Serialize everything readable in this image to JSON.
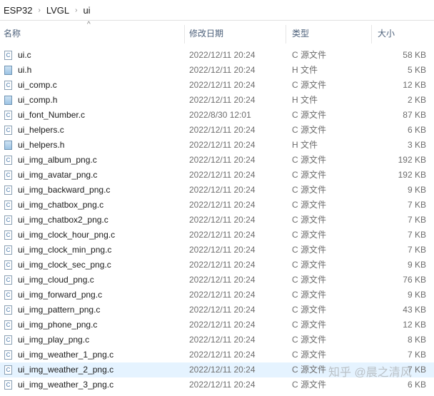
{
  "breadcrumb": [
    "ESP32",
    "LVGL",
    "ui"
  ],
  "columns": {
    "name": "名称",
    "modified": "修改日期",
    "type": "类型",
    "size": "大小"
  },
  "files": [
    {
      "name": "ui.c",
      "date": "2022/12/11 20:24",
      "type": "C 源文件",
      "size": "58 KB",
      "icon": "c"
    },
    {
      "name": "ui.h",
      "date": "2022/12/11 20:24",
      "type": "H 文件",
      "size": "5 KB",
      "icon": "h"
    },
    {
      "name": "ui_comp.c",
      "date": "2022/12/11 20:24",
      "type": "C 源文件",
      "size": "12 KB",
      "icon": "c"
    },
    {
      "name": "ui_comp.h",
      "date": "2022/12/11 20:24",
      "type": "H 文件",
      "size": "2 KB",
      "icon": "h"
    },
    {
      "name": "ui_font_Number.c",
      "date": "2022/8/30 12:01",
      "type": "C 源文件",
      "size": "87 KB",
      "icon": "c"
    },
    {
      "name": "ui_helpers.c",
      "date": "2022/12/11 20:24",
      "type": "C 源文件",
      "size": "6 KB",
      "icon": "c"
    },
    {
      "name": "ui_helpers.h",
      "date": "2022/12/11 20:24",
      "type": "H 文件",
      "size": "3 KB",
      "icon": "h"
    },
    {
      "name": "ui_img_album_png.c",
      "date": "2022/12/11 20:24",
      "type": "C 源文件",
      "size": "192 KB",
      "icon": "c"
    },
    {
      "name": "ui_img_avatar_png.c",
      "date": "2022/12/11 20:24",
      "type": "C 源文件",
      "size": "192 KB",
      "icon": "c"
    },
    {
      "name": "ui_img_backward_png.c",
      "date": "2022/12/11 20:24",
      "type": "C 源文件",
      "size": "9 KB",
      "icon": "c"
    },
    {
      "name": "ui_img_chatbox_png.c",
      "date": "2022/12/11 20:24",
      "type": "C 源文件",
      "size": "7 KB",
      "icon": "c"
    },
    {
      "name": "ui_img_chatbox2_png.c",
      "date": "2022/12/11 20:24",
      "type": "C 源文件",
      "size": "7 KB",
      "icon": "c"
    },
    {
      "name": "ui_img_clock_hour_png.c",
      "date": "2022/12/11 20:24",
      "type": "C 源文件",
      "size": "7 KB",
      "icon": "c"
    },
    {
      "name": "ui_img_clock_min_png.c",
      "date": "2022/12/11 20:24",
      "type": "C 源文件",
      "size": "7 KB",
      "icon": "c"
    },
    {
      "name": "ui_img_clock_sec_png.c",
      "date": "2022/12/11 20:24",
      "type": "C 源文件",
      "size": "9 KB",
      "icon": "c"
    },
    {
      "name": "ui_img_cloud_png.c",
      "date": "2022/12/11 20:24",
      "type": "C 源文件",
      "size": "76 KB",
      "icon": "c"
    },
    {
      "name": "ui_img_forward_png.c",
      "date": "2022/12/11 20:24",
      "type": "C 源文件",
      "size": "9 KB",
      "icon": "c"
    },
    {
      "name": "ui_img_pattern_png.c",
      "date": "2022/12/11 20:24",
      "type": "C 源文件",
      "size": "43 KB",
      "icon": "c"
    },
    {
      "name": "ui_img_phone_png.c",
      "date": "2022/12/11 20:24",
      "type": "C 源文件",
      "size": "12 KB",
      "icon": "c"
    },
    {
      "name": "ui_img_play_png.c",
      "date": "2022/12/11 20:24",
      "type": "C 源文件",
      "size": "8 KB",
      "icon": "c"
    },
    {
      "name": "ui_img_weather_1_png.c",
      "date": "2022/12/11 20:24",
      "type": "C 源文件",
      "size": "7 KB",
      "icon": "c"
    },
    {
      "name": "ui_img_weather_2_png.c",
      "date": "2022/12/11 20:24",
      "type": "C 源文件",
      "size": "7 KB",
      "icon": "c",
      "hover": true
    },
    {
      "name": "ui_img_weather_3_png.c",
      "date": "2022/12/11 20:24",
      "type": "C 源文件",
      "size": "6 KB",
      "icon": "c"
    }
  ],
  "watermark": "知乎 @晨之清风"
}
